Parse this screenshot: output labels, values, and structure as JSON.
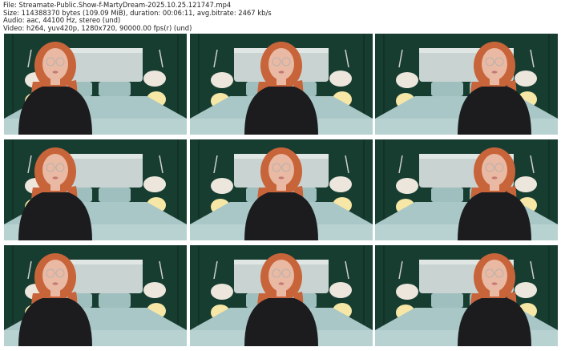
{
  "header": {
    "file": "File: Streamate-Public.Show-f-MartyDream-2025.10.25.121747.mp4",
    "size": "Size: 114388370 bytes (109.09 MiB), duration: 00:06:11, avg.bitrate: 2467 kb/s",
    "audio": "Audio: aac, 44100 Hz, stereo (und)",
    "video": "Video: h264, yuv420p, 1280x720, 90000.00 fps(r) (und)"
  },
  "frames": [
    {
      "row": 1,
      "col": 1,
      "icon": "video-frame-thumbnail"
    },
    {
      "row": 1,
      "col": 2,
      "icon": "video-frame-thumbnail"
    },
    {
      "row": 1,
      "col": 3,
      "icon": "video-frame-thumbnail"
    },
    {
      "row": 2,
      "col": 1,
      "icon": "video-frame-thumbnail"
    },
    {
      "row": 2,
      "col": 2,
      "icon": "video-frame-thumbnail"
    },
    {
      "row": 2,
      "col": 3,
      "icon": "video-frame-thumbnail"
    },
    {
      "row": 3,
      "col": 1,
      "icon": "video-frame-thumbnail"
    },
    {
      "row": 3,
      "col": 2,
      "icon": "video-frame-thumbnail"
    },
    {
      "row": 3,
      "col": 3,
      "icon": "video-frame-thumbnail"
    }
  ],
  "colors": {
    "wall": "#173d31",
    "bed": "#a9c7c6",
    "hair": "#c8643a",
    "sweater": "#1c1c1f",
    "skin": "#e9b9a3"
  }
}
